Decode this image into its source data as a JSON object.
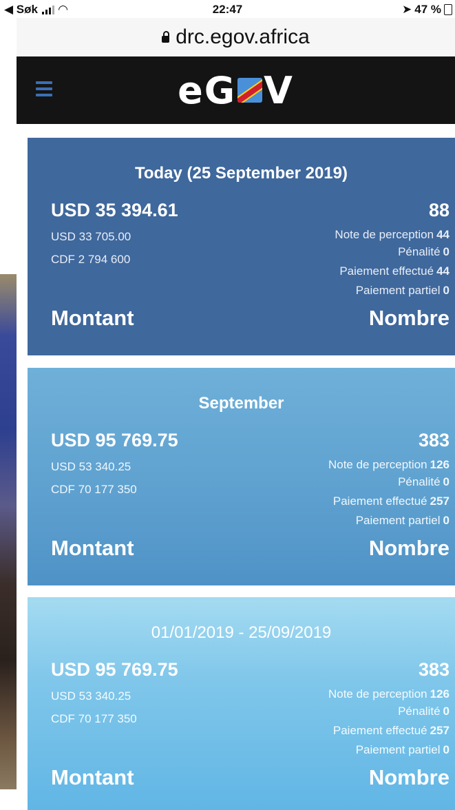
{
  "status_bar": {
    "back_label": "◀ Søk",
    "time": "22:47",
    "battery": "47 %"
  },
  "browser": {
    "url": "drc.egov.africa"
  },
  "header": {
    "logo_part1": "eG",
    "logo_part2": "V"
  },
  "cards": [
    {
      "title": "Today (25 September 2019)",
      "total": "USD 35 394.61",
      "count": "88",
      "sub_usd": "USD 33 705.00",
      "sub_cdf": "CDF 2 794 600",
      "rows": [
        {
          "label": "Note de perception",
          "value": "44"
        },
        {
          "label": "Pénalité",
          "value": "0"
        },
        {
          "label": "Paiement effectué",
          "value": "44"
        },
        {
          "label": "Paiement partiel",
          "value": "0"
        }
      ],
      "left_footer": "Montant",
      "right_footer": "Nombre"
    },
    {
      "title": "September",
      "total": "USD 95 769.75",
      "count": "383",
      "sub_usd": "USD 53 340.25",
      "sub_cdf": "CDF 70 177 350",
      "rows": [
        {
          "label": "Note de perception",
          "value": "126"
        },
        {
          "label": "Pénalité",
          "value": "0"
        },
        {
          "label": "Paiement effectué",
          "value": "257"
        },
        {
          "label": "Paiement partiel",
          "value": "0"
        }
      ],
      "left_footer": "Montant",
      "right_footer": "Nombre"
    },
    {
      "title": "01/01/2019 - 25/09/2019",
      "total": "USD 95 769.75",
      "count": "383",
      "sub_usd": "USD 53 340.25",
      "sub_cdf": "CDF 70 177 350",
      "rows": [
        {
          "label": "Note de perception",
          "value": "126"
        },
        {
          "label": "Pénalité",
          "value": "0"
        },
        {
          "label": "Paiement effectué",
          "value": "257"
        },
        {
          "label": "Paiement partiel",
          "value": "0"
        }
      ],
      "left_footer": "Montant",
      "right_footer": "Nombre"
    }
  ],
  "colors": {
    "header_bg": "#141414",
    "hamburger": "#3a6fb5",
    "card_today": "#3f689c",
    "card_month": "#5da0cf",
    "card_range": "#7fc6ea"
  }
}
